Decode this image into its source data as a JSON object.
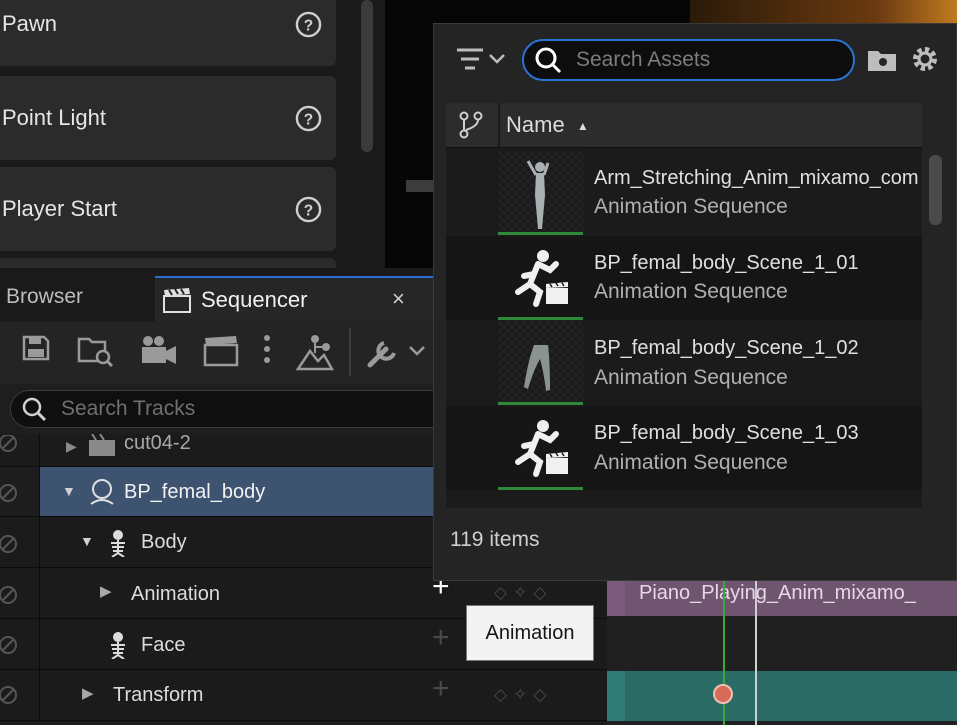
{
  "place_actors": {
    "items": [
      {
        "label": "Pawn"
      },
      {
        "label": "Point Light"
      },
      {
        "label": "Player Start"
      }
    ]
  },
  "tabs": {
    "browser_label": "Browser",
    "sequencer_label": "Sequencer",
    "close_symbol": "×"
  },
  "sequencer": {
    "search_placeholder": "Search Tracks",
    "tracks": [
      {
        "label": "cut04-2",
        "icon": "film-clip-icon"
      },
      {
        "label": "BP_femal_body",
        "icon": "actor-icon",
        "selected": true
      },
      {
        "label": "Body",
        "icon": "skeleton-icon"
      },
      {
        "label": "Animation",
        "icon": "none"
      },
      {
        "label": "Face",
        "icon": "skeleton-icon"
      },
      {
        "label": "Transform",
        "icon": "none"
      }
    ],
    "add_symbol": "+",
    "timeline_section_label": "Piano_Playing_Anim_mixamo_"
  },
  "tooltip": {
    "text": "Animation"
  },
  "asset_picker": {
    "search_placeholder": "Search Assets",
    "column_name": "Name",
    "sort_symbol": "▲",
    "assets": [
      {
        "name": "Arm_Stretching_Anim_mixamo_com",
        "type": "Animation Sequence",
        "thumb": "mannequin"
      },
      {
        "name": "BP_femal_body_Scene_1_01",
        "type": "Animation Sequence",
        "thumb": "running-figure-icon"
      },
      {
        "name": "BP_femal_body_Scene_1_02",
        "type": "Animation Sequence",
        "thumb": "legs"
      },
      {
        "name": "BP_femal_body_Scene_1_03",
        "type": "Animation Sequence",
        "thumb": "running-figure-icon"
      }
    ],
    "item_count": "119 items"
  },
  "colors": {
    "accent_blue": "#2a73d4",
    "anim_section": "#6f556f",
    "transform_section": "#2b6b66",
    "playhead": "#38a838"
  }
}
